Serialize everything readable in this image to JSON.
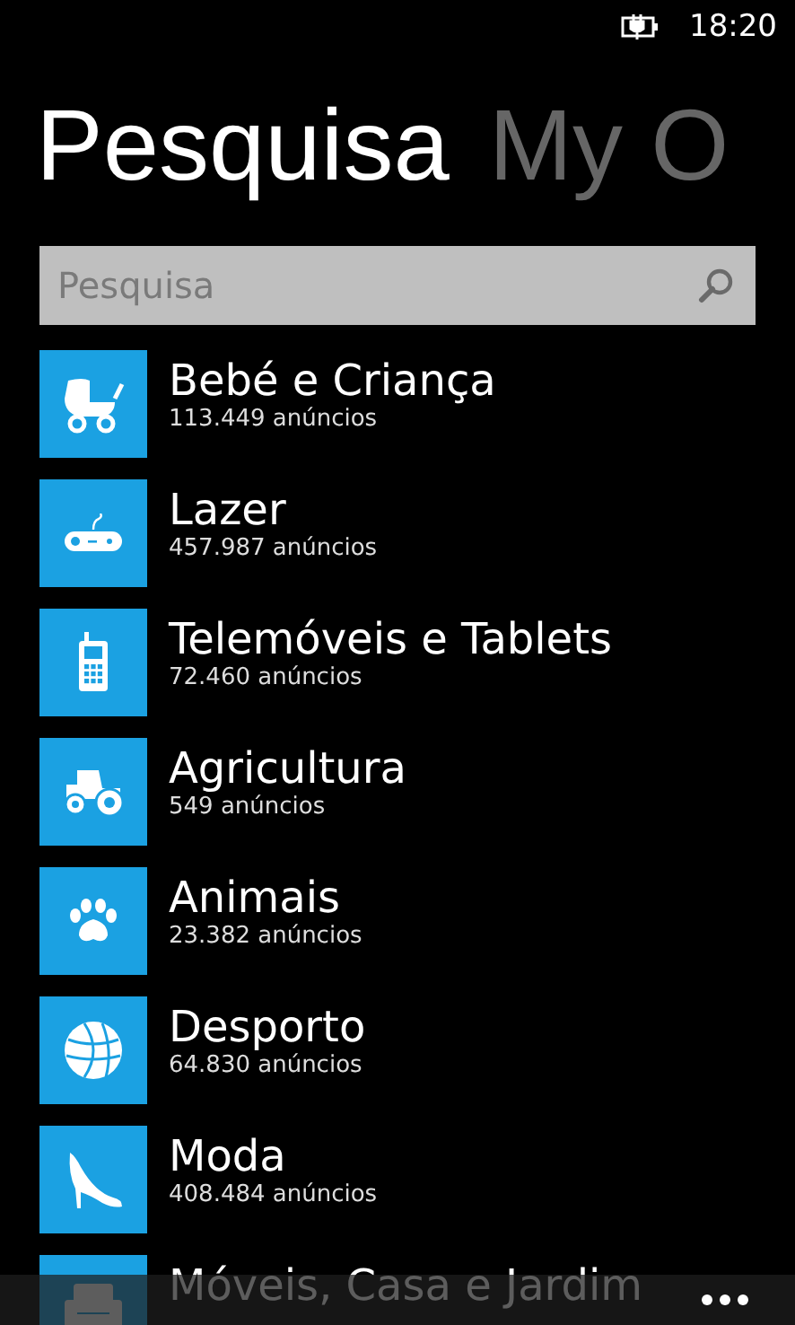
{
  "status_bar": {
    "time": "18:20"
  },
  "pivot": [
    {
      "label": "Pesquisa",
      "selected": true
    },
    {
      "label": "My O",
      "selected": false
    }
  ],
  "search": {
    "placeholder": "Pesquisa"
  },
  "categories": [
    {
      "name": "Bebé e Criança",
      "count": "113.449 anúncios"
    },
    {
      "name": "Lazer",
      "count": "457.987 anúncios"
    },
    {
      "name": "Telemóveis e Tablets",
      "count": "72.460 anúncios"
    },
    {
      "name": "Agricultura",
      "count": "549 anúncios"
    },
    {
      "name": "Animais",
      "count": "23.382 anúncios"
    },
    {
      "name": "Desporto",
      "count": "64.830 anúncios"
    },
    {
      "name": "Moda",
      "count": "408.484 anúncios"
    },
    {
      "name": "Móveis, Casa e Jardim"
    }
  ]
}
